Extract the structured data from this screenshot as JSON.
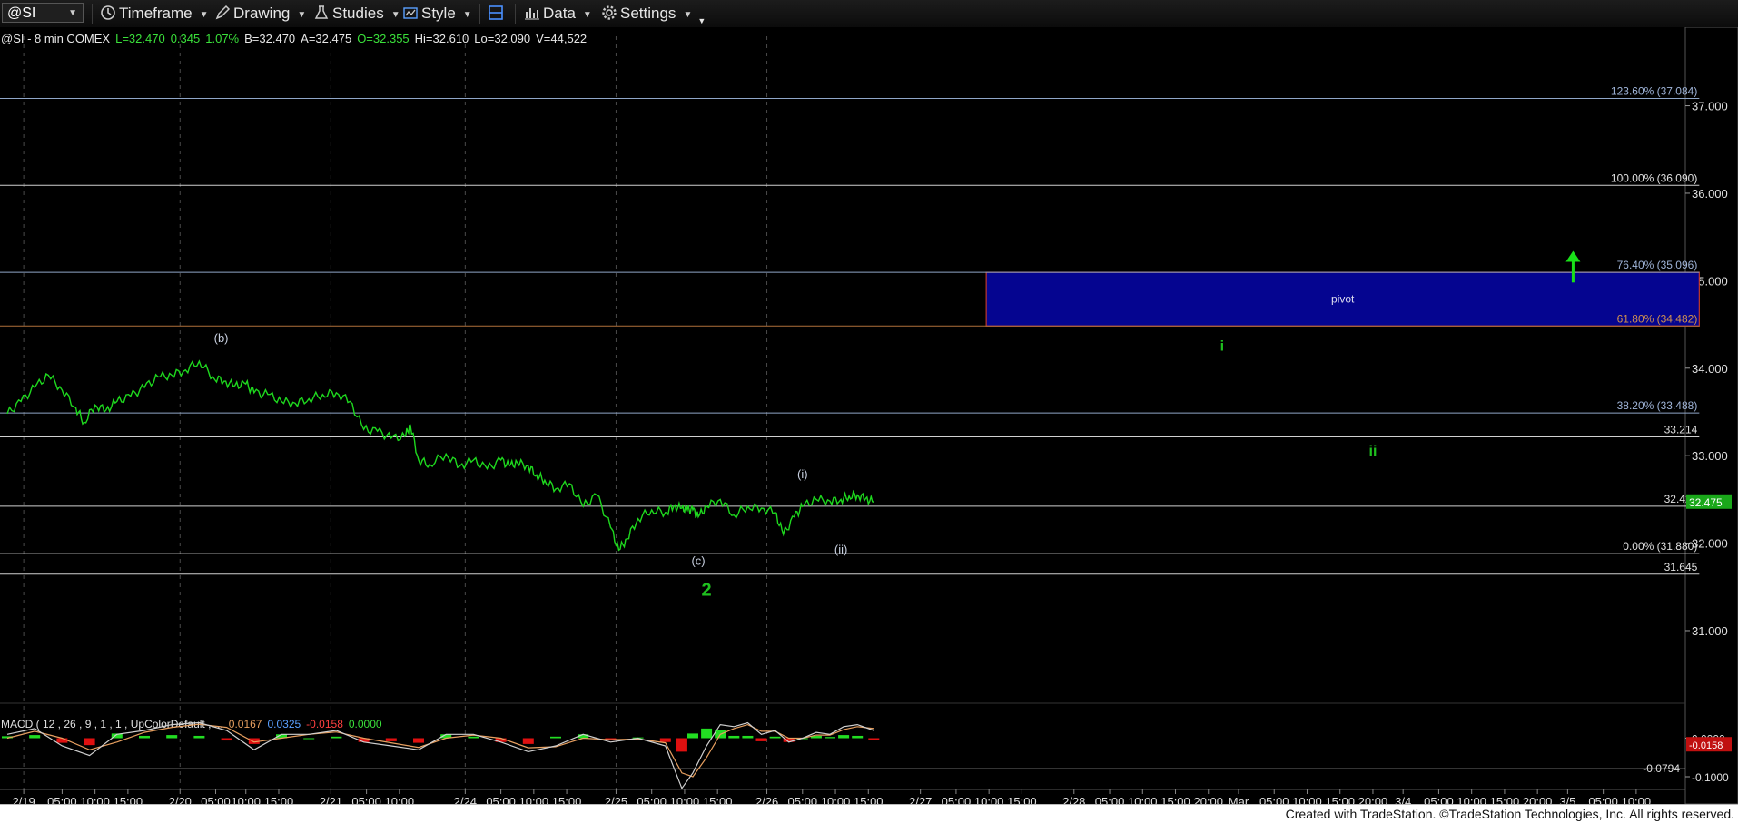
{
  "toolbar": {
    "symbol": "@SI",
    "timeframe_label": "Timeframe",
    "drawing_label": "Drawing",
    "studies_label": "Studies",
    "style_label": "Style",
    "data_label": "Data",
    "settings_label": "Settings"
  },
  "footer": {
    "text": "Created with TradeStation. ©TradeStation Technologies, Inc. All rights reserved."
  },
  "chart_data": {
    "type": "line",
    "header": {
      "symbol_interval_exchange": "@SI - 8 min  COMEX",
      "last": "L=32.470",
      "change": "0.345",
      "change_pct": "1.07%",
      "bid": "B=32.470",
      "ask": "A=32.475",
      "open": "O=32.355",
      "high": "Hi=32.610",
      "low": "Lo=32.090",
      "volume": "V=44,522"
    },
    "colors": {
      "price": "#1ed81e",
      "wave_primary": "#1fc11f",
      "wave_minor": "#c8d0e0",
      "zone_fill": "#050590",
      "zone_border": "#c0392b",
      "fib": "#8fa6c8",
      "level": "#d0d0d0",
      "arrow": "#19e019",
      "last_badge": "#1aa81a",
      "macd_line": "#d0d0d0",
      "macd_signal": "#e8a060",
      "macd_hist_up": "#22dd22",
      "macd_hist_down": "#e01010"
    },
    "y_axis": {
      "range": [
        30.45,
        37.4
      ],
      "ticks": [
        "37.000",
        "36.000",
        "35.000",
        "34.000",
        "33.000",
        "32.000",
        "31.000"
      ]
    },
    "x_axis": {
      "range": [
        0,
        54
      ],
      "ticks": [
        {
          "x": 0.6,
          "label": "2/19"
        },
        {
          "x": 2.0,
          "label": "05:00"
        },
        {
          "x": 3.2,
          "label": "10:00"
        },
        {
          "x": 4.4,
          "label": "15:00"
        },
        {
          "x": 6.3,
          "label": "2/20"
        },
        {
          "x": 7.6,
          "label": "05:00"
        },
        {
          "x": 8.7,
          "label": "10:00"
        },
        {
          "x": 9.9,
          "label": "15:00"
        },
        {
          "x": 11.8,
          "label": "2/21"
        },
        {
          "x": 13.1,
          "label": "05:00"
        },
        {
          "x": 14.3,
          "label": "10:00"
        },
        {
          "x": 16.7,
          "label": "2/24"
        },
        {
          "x": 18.0,
          "label": "05:00"
        },
        {
          "x": 19.2,
          "label": "10:00"
        },
        {
          "x": 20.4,
          "label": "15:00"
        },
        {
          "x": 22.2,
          "label": "2/25"
        },
        {
          "x": 23.5,
          "label": "05:00"
        },
        {
          "x": 24.7,
          "label": "10:00"
        },
        {
          "x": 25.9,
          "label": "15:00"
        },
        {
          "x": 27.7,
          "label": "2/26"
        },
        {
          "x": 29.0,
          "label": "05:00"
        },
        {
          "x": 30.2,
          "label": "10:00"
        },
        {
          "x": 31.4,
          "label": "15:00"
        },
        {
          "x": 33.3,
          "label": "2/27"
        },
        {
          "x": 34.6,
          "label": "05:00"
        },
        {
          "x": 35.8,
          "label": "10:00"
        },
        {
          "x": 37.0,
          "label": "15:00"
        },
        {
          "x": 38.9,
          "label": "2/28"
        },
        {
          "x": 40.2,
          "label": "05:00"
        },
        {
          "x": 41.4,
          "label": "10:00"
        },
        {
          "x": 42.6,
          "label": "15:00"
        },
        {
          "x": 43.8,
          "label": "20:00"
        },
        {
          "x": 44.9,
          "label": "Mar"
        },
        {
          "x": 46.2,
          "label": "05:00"
        },
        {
          "x": 47.4,
          "label": "10:00"
        },
        {
          "x": 48.6,
          "label": "15:00"
        },
        {
          "x": 49.8,
          "label": "20:00"
        },
        {
          "x": 50.9,
          "label": "3/4"
        },
        {
          "x": 52.2,
          "label": "05:00"
        },
        {
          "x": 53.4,
          "label": "10:00"
        },
        {
          "x": 54.6,
          "label": "15:00"
        },
        {
          "x": 55.8,
          "label": "20:00"
        },
        {
          "x": 56.9,
          "label": "3/5"
        },
        {
          "x": 58.2,
          "label": "05:00"
        },
        {
          "x": 59.4,
          "label": "10:00"
        }
      ],
      "day_separators": [
        0.6,
        6.3,
        11.8,
        16.7,
        22.2,
        27.7
      ]
    },
    "series": [
      {
        "x": [
          0,
          0.5,
          1,
          1.5,
          2,
          2.5,
          2.8,
          3.2,
          3.6,
          4,
          4.5,
          5,
          5.5,
          6,
          6.5,
          7,
          7.5,
          7.9,
          8.3,
          8.7,
          9,
          9.5,
          10,
          10.5,
          11,
          11.5,
          12,
          12.5,
          13,
          13.5,
          14,
          14.5,
          14.7,
          15,
          15.4,
          16,
          16.5,
          17,
          17.5,
          18,
          18.3,
          18.6,
          19,
          19.3,
          19.6,
          20,
          20.5,
          21,
          21.5,
          22,
          22.3,
          22.6,
          23,
          23.5,
          24,
          24.3,
          24.6,
          24.8,
          25,
          25.2,
          25.5,
          26,
          26.5,
          27,
          27.5,
          28,
          28.3,
          28.7,
          29,
          29.5,
          30,
          30.4,
          30.7,
          31,
          31.3,
          31.6
        ],
        "values": [
          33.48,
          33.62,
          33.78,
          33.92,
          33.75,
          33.55,
          33.38,
          33.58,
          33.52,
          33.62,
          33.68,
          33.78,
          33.9,
          33.92,
          33.98,
          34.08,
          33.9,
          33.85,
          33.8,
          33.82,
          33.72,
          33.7,
          33.62,
          33.6,
          33.65,
          33.7,
          33.72,
          33.62,
          33.3,
          33.28,
          33.2,
          33.22,
          33.35,
          32.95,
          32.9,
          33.02,
          32.88,
          32.95,
          32.85,
          32.95,
          32.88,
          32.92,
          32.88,
          32.78,
          32.72,
          32.62,
          32.68,
          32.42,
          32.55,
          32.18,
          31.92,
          32.05,
          32.28,
          32.38,
          32.35,
          32.42,
          32.4,
          32.38,
          32.38,
          32.3,
          32.42,
          32.5,
          32.32,
          32.42,
          32.4,
          32.35,
          32.1,
          32.3,
          32.42,
          32.5,
          32.48,
          32.5,
          32.54,
          32.55,
          32.51,
          32.47
        ]
      }
    ],
    "levels": [
      {
        "label": "123.60% (37.084)",
        "value": 37.084,
        "kind": "fib"
      },
      {
        "label": "100.00% (36.090)",
        "value": 36.09,
        "kind": "level"
      },
      {
        "label": "76.40% (35.096)",
        "value": 35.096,
        "kind": "fib"
      },
      {
        "label": "61.80% (34.482)",
        "value": 34.482,
        "kind": "fib-red"
      },
      {
        "label": "38.20% (33.488)",
        "value": 33.488,
        "kind": "fib"
      },
      {
        "label": "33.214",
        "value": 33.214,
        "kind": "level"
      },
      {
        "label": "32.422",
        "value": 32.422,
        "kind": "level"
      },
      {
        "label": "0.00% (31.880)",
        "value": 31.88,
        "kind": "level"
      },
      {
        "label": "31.645",
        "value": 31.645,
        "kind": "level"
      }
    ],
    "zone": {
      "label": "pivot",
      "x_start": 35.7,
      "x_end": 61.7,
      "y_low": 34.482,
      "y_high": 35.096
    },
    "wave_labels": [
      {
        "text": "(b)",
        "x": 7.8,
        "y": 34.3,
        "style": "minor"
      },
      {
        "text": "(c)",
        "x": 25.2,
        "y": 31.75,
        "style": "minor"
      },
      {
        "text": "2",
        "x": 25.5,
        "y": 31.4,
        "style": "primary"
      },
      {
        "text": "(i)",
        "x": 29.0,
        "y": 32.74,
        "style": "minor"
      },
      {
        "text": "(ii)",
        "x": 30.4,
        "y": 31.88,
        "style": "minor"
      },
      {
        "text": "i",
        "x": 44.3,
        "y": 34.2,
        "style": "primary"
      },
      {
        "text": "ii",
        "x": 49.8,
        "y": 33.0,
        "style": "primary"
      }
    ],
    "arrow": {
      "x": 57.1,
      "y_from": 34.98,
      "y_to": 35.32
    },
    "last_price": {
      "value": 32.475,
      "label": "32.475"
    },
    "macd": {
      "label": "MACD ( 12 , 26 , 9 , 1 , 1 , UpColorDefault , ...",
      "values": [
        "0.0167",
        "0.0325",
        "-0.0158",
        "0.0000"
      ],
      "ticks": [
        {
          "value": 0.0,
          "label": "0.0000"
        },
        {
          "value": -0.1,
          "label": "-0.1000"
        }
      ],
      "level": {
        "value": -0.0794,
        "label": "-0.0794"
      },
      "last_label": "-0.0158",
      "range": [
        -0.14,
        0.06
      ],
      "x": [
        0,
        1,
        2,
        3,
        4,
        5,
        6,
        7,
        8,
        9,
        10,
        11,
        12,
        13,
        14,
        15,
        16,
        17,
        18,
        19,
        20,
        21,
        22,
        23,
        24,
        24.6,
        25,
        25.5,
        26,
        26.5,
        27,
        27.5,
        28,
        28.5,
        29,
        29.5,
        30,
        30.5,
        31,
        31.6
      ],
      "line": [
        0.01,
        0.025,
        -0.02,
        -0.045,
        0.01,
        0.02,
        0.035,
        0.04,
        0.02,
        -0.03,
        0.01,
        0.01,
        0.02,
        -0.01,
        -0.02,
        -0.03,
        0.01,
        0.01,
        -0.01,
        -0.035,
        -0.02,
        0.01,
        -0.01,
        0.0,
        -0.02,
        -0.13,
        -0.09,
        -0.02,
        0.035,
        0.03,
        0.04,
        0.01,
        0.02,
        -0.01,
        0.0,
        0.015,
        0.01,
        0.03,
        0.035,
        0.02
      ],
      "signal": [
        0.0,
        0.018,
        0.0,
        -0.03,
        -0.01,
        0.015,
        0.028,
        0.036,
        0.028,
        -0.01,
        0.0,
        0.01,
        0.016,
        0.0,
        -0.012,
        -0.024,
        0.0,
        0.008,
        0.0,
        -0.025,
        -0.022,
        0.0,
        -0.004,
        -0.002,
        -0.012,
        -0.09,
        -0.1,
        -0.05,
        0.01,
        0.025,
        0.035,
        0.018,
        0.018,
        0.0,
        0.0,
        0.008,
        0.008,
        0.022,
        0.03,
        0.025
      ],
      "hist": [
        0.005,
        0.008,
        -0.012,
        -0.018,
        0.012,
        0.006,
        0.008,
        0.006,
        -0.006,
        -0.015,
        0.01,
        0.0,
        0.004,
        -0.01,
        -0.008,
        -0.012,
        0.01,
        0.004,
        -0.01,
        -0.015,
        0.004,
        0.01,
        -0.006,
        0.002,
        -0.01,
        -0.035,
        0.012,
        0.025,
        0.022,
        0.006,
        0.006,
        -0.008,
        0.004,
        -0.01,
        0.0,
        0.006,
        0.003,
        0.008,
        0.006,
        -0.005
      ]
    }
  }
}
